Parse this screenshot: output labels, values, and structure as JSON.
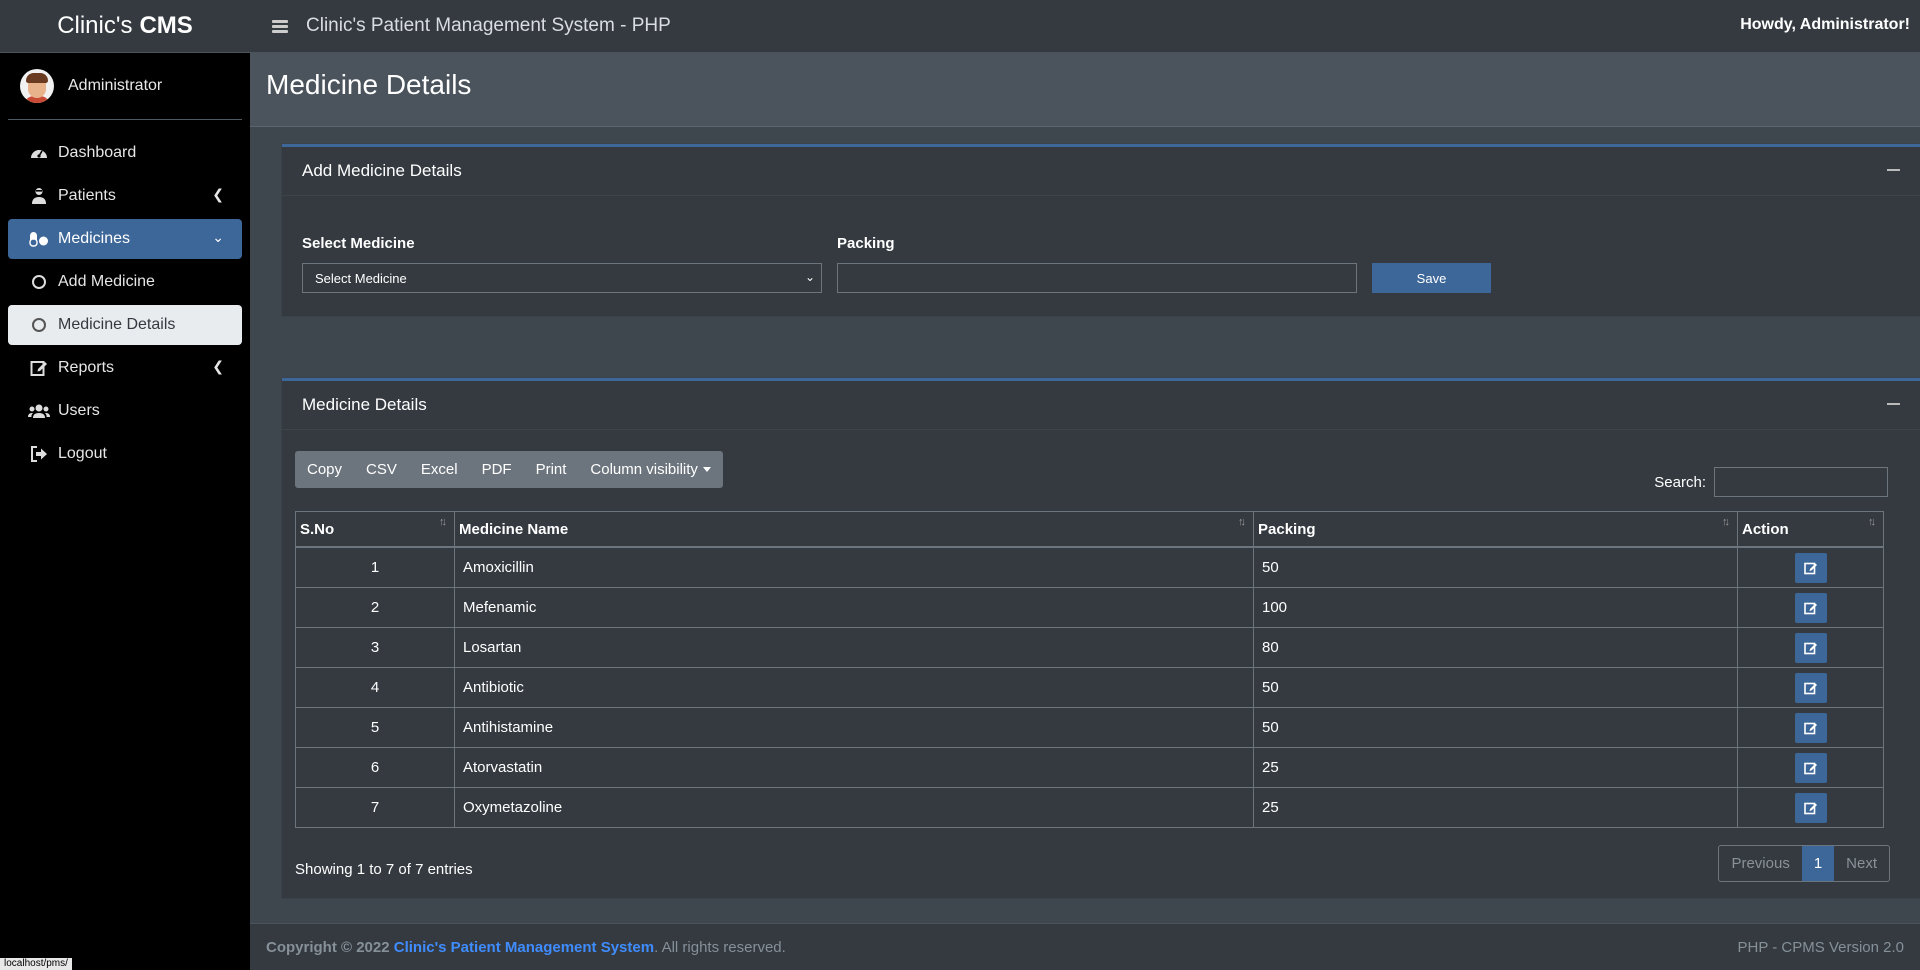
{
  "brand": {
    "name": "Clinic's",
    "bold": "CMS"
  },
  "user": {
    "name": "Administrator"
  },
  "sidebar": {
    "items": [
      {
        "label": "Dashboard",
        "icon": "dashboard-icon"
      },
      {
        "label": "Patients",
        "icon": "user-injured-icon"
      },
      {
        "label": "Medicines",
        "icon": "pills-icon"
      },
      {
        "label": "Add Medicine",
        "icon": "circle-icon"
      },
      {
        "label": "Medicine Details",
        "icon": "circle-icon"
      },
      {
        "label": "Reports",
        "icon": "edit-icon"
      },
      {
        "label": "Users",
        "icon": "users-icon"
      },
      {
        "label": "Logout",
        "icon": "logout-icon"
      }
    ]
  },
  "header": {
    "title": "Clinic's Patient Management System - PHP",
    "greeting": "Howdy, Administrator!"
  },
  "page": {
    "title": "Medicine Details"
  },
  "add_card": {
    "title": "Add Medicine Details",
    "select_label": "Select Medicine",
    "select_value": "Select Medicine",
    "packing_label": "Packing",
    "packing_value": "",
    "save_label": "Save"
  },
  "list_card": {
    "title": "Medicine Details",
    "buttons": [
      "Copy",
      "CSV",
      "Excel",
      "PDF",
      "Print",
      "Column visibility"
    ],
    "search_label": "Search:",
    "columns": [
      "S.No",
      "Medicine Name",
      "Packing",
      "Action"
    ],
    "rows": [
      {
        "sno": "1",
        "name": "Amoxicillin",
        "packing": "50"
      },
      {
        "sno": "2",
        "name": "Mefenamic",
        "packing": "100"
      },
      {
        "sno": "3",
        "name": "Losartan",
        "packing": "80"
      },
      {
        "sno": "4",
        "name": "Antibiotic",
        "packing": "50"
      },
      {
        "sno": "5",
        "name": "Antihistamine",
        "packing": "50"
      },
      {
        "sno": "6",
        "name": "Atorvastatin",
        "packing": "25"
      },
      {
        "sno": "7",
        "name": "Oxymetazoline",
        "packing": "25"
      }
    ],
    "showing": "Showing 1 to 7 of 7 entries",
    "pagination": {
      "previous": "Previous",
      "current": "1",
      "next": "Next"
    }
  },
  "footer": {
    "copyright": "Copyright © 2022",
    "link": "Clinic's Patient Management System",
    "rights": ". All rights reserved.",
    "version": "PHP - CPMS Version 2.0"
  },
  "status_url": "localhost/pms/",
  "colors": {
    "accent": "#3e6799",
    "sidebar_bg": "#000000",
    "content_bg": "#454d55"
  }
}
